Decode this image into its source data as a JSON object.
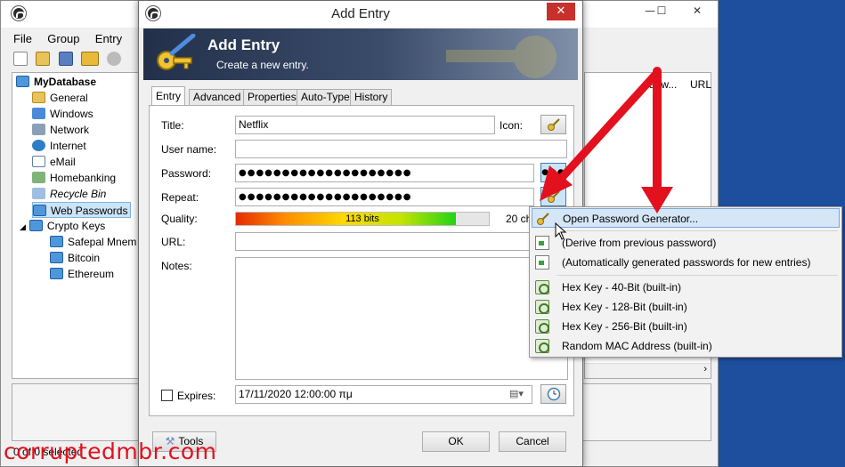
{
  "main_window": {
    "menu": [
      "File",
      "Group",
      "Entry"
    ],
    "tree": {
      "root": "MyDatabase",
      "groups": [
        "General",
        "Windows",
        "Network",
        "Internet",
        "eMail",
        "Homebanking",
        "Recycle Bin",
        "Web Passwords",
        "Crypto Keys"
      ],
      "crypto_children": [
        "Safepal Mnem",
        "Bitcoin",
        "Ethereum"
      ],
      "selected": "Web Passwords"
    },
    "list_columns": [
      "a..w...",
      "URL"
    ],
    "status": "0 of 0 selected"
  },
  "dialog": {
    "window_title": "Add Entry",
    "banner_title": "Add Entry",
    "banner_subtitle": "Create a new entry.",
    "tabs": [
      "Entry",
      "Advanced",
      "Properties",
      "Auto-Type",
      "History"
    ],
    "active_tab": "Entry",
    "fields": {
      "title_label": "Title:",
      "title_value": "Netflix",
      "icon_label": "Icon:",
      "username_label": "User name:",
      "username_value": "",
      "password_label": "Password:",
      "password_value": "●●●●●●●●●●●●●●●●●●●●",
      "password_toggle": "●●●",
      "repeat_label": "Repeat:",
      "repeat_value": "●●●●●●●●●●●●●●●●●●●●",
      "quality_label": "Quality:",
      "quality_text": "113 bits",
      "quality_fraction": 0.87,
      "char_count": "20 ch.",
      "url_label": "URL:",
      "url_value": "",
      "notes_label": "Notes:",
      "notes_value": "",
      "expires_label": "Expires:",
      "expires_checked": false,
      "expires_value": "17/11/2020 12:00:00 πμ"
    },
    "buttons": {
      "tools": "Tools",
      "ok": "OK",
      "cancel": "Cancel"
    }
  },
  "context_menu": {
    "items": [
      {
        "label": "Open Password Generator...",
        "icon": "key-icon",
        "highlighted": true
      },
      {
        "label": "(Derive from previous password)",
        "icon": "doc-icon",
        "highlighted": false
      },
      {
        "label": "(Automatically generated passwords for new entries)",
        "icon": "doc-icon",
        "highlighted": false
      },
      {
        "label": "Hex Key - 40-Bit (built-in)",
        "icon": "generator-icon",
        "highlighted": false
      },
      {
        "label": "Hex Key - 128-Bit (built-in)",
        "icon": "generator-icon",
        "highlighted": false
      },
      {
        "label": "Hex Key - 256-Bit (built-in)",
        "icon": "generator-icon",
        "highlighted": false
      },
      {
        "label": "Random MAC Address (built-in)",
        "icon": "generator-icon",
        "highlighted": false
      }
    ]
  },
  "watermark": "corruptedmbr.com",
  "colors": {
    "annotation_arrow": "#e3101d",
    "menu_highlight": "#d5e6f7",
    "desktop": "#1e4f9e"
  }
}
